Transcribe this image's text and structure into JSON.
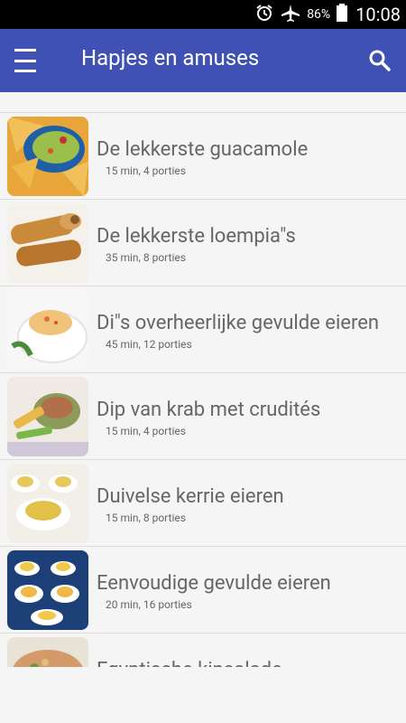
{
  "status_bar": {
    "battery": "86%",
    "time": "10:08",
    "icons": [
      "alarm-icon",
      "airplane-mode-icon",
      "battery-icon"
    ]
  },
  "app_bar": {
    "title": "Hapjes en amuses",
    "menu_icon": "hamburger-menu-icon",
    "search_icon": "search-icon"
  },
  "recipes": [
    {
      "title": "De lekkerste guacamole",
      "meta": "15 min, 4 porties"
    },
    {
      "title": "De lekkerste loempia\"s",
      "meta": "35 min, 8 porties"
    },
    {
      "title": "Di\"s overheerlijke gevulde eieren",
      "meta": "45 min, 12 porties"
    },
    {
      "title": "Dip van krab met crudités",
      "meta": "15 min, 4 porties"
    },
    {
      "title": "Duivelse kerrie eieren",
      "meta": "15 min, 8 porties"
    },
    {
      "title": "Eenvoudige gevulde eieren",
      "meta": "20 min, 16 porties"
    },
    {
      "title": "Egyptische kipsalade",
      "meta": ""
    }
  ],
  "colors": {
    "app_bar": "#3f51b5",
    "status_bar": "#000000",
    "background": "#f5f5f5",
    "text": "#666666"
  }
}
